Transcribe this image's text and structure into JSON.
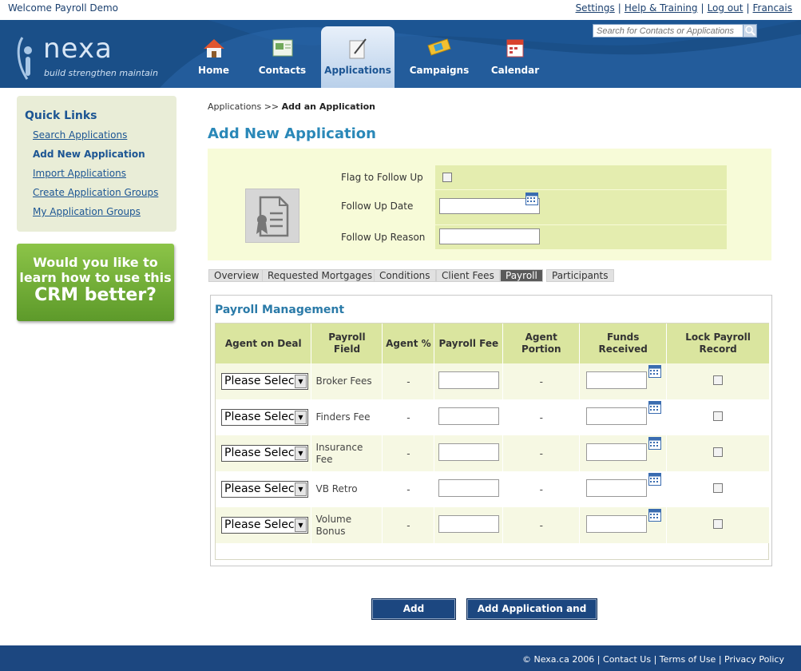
{
  "user": {
    "welcome": "Welcome Payroll Demo"
  },
  "top_links": [
    "Settings",
    "Help & Training",
    "Log out",
    "Francais"
  ],
  "logo": {
    "word": "nexa",
    "tagline": "build strengthen maintain"
  },
  "nav": [
    {
      "label": "Home",
      "icon": "house-icon"
    },
    {
      "label": "Contacts",
      "icon": "contacts-icon"
    },
    {
      "label": "Applications",
      "icon": "pen-document-icon",
      "active": true
    },
    {
      "label": "Campaigns",
      "icon": "campaign-icon"
    },
    {
      "label": "Calendar",
      "icon": "calendar-icon"
    }
  ],
  "search": {
    "placeholder": "Search for Contacts or Applications"
  },
  "quick_links": {
    "title": "Quick Links",
    "items": [
      "Search Applications",
      "Add New Application",
      "Import Applications",
      "Create Application Groups",
      "My Application Groups"
    ]
  },
  "promo": {
    "line1": "Would you like to",
    "line2": "learn how to use this",
    "line3": "CRM better?"
  },
  "breadcrumb": {
    "root": "Applications",
    "sep": ">>",
    "current": "Add an Application"
  },
  "page_title": "Add New Application",
  "follow_up": {
    "flag_label": "Flag to Follow Up",
    "date_label": "Follow Up Date",
    "reason_label": "Follow Up Reason"
  },
  "tabs": [
    "Overview",
    "Requested Mortgages",
    "Conditions",
    "Client Fees",
    "Payroll",
    "Participants"
  ],
  "active_tab": "Payroll",
  "payroll": {
    "title": "Payroll Management",
    "headers": [
      "Agent on Deal",
      "Payroll Field",
      "Agent %",
      "Payroll Fee",
      "Agent Portion",
      "Funds Received",
      "Lock Payroll Record"
    ],
    "select_value": "Please Select",
    "rows": [
      {
        "field": "Broker Fees",
        "agent_pct": "-",
        "agent_portion": "-"
      },
      {
        "field": "Finders Fee",
        "agent_pct": "-",
        "agent_portion": "-"
      },
      {
        "field": "Insurance Fee",
        "agent_pct": "-",
        "agent_portion": "-"
      },
      {
        "field": "VB Retro",
        "agent_pct": "-",
        "agent_portion": "-"
      },
      {
        "field": "Volume Bonus",
        "agent_pct": "-",
        "agent_portion": "-"
      }
    ]
  },
  "buttons": {
    "add": "Add Application",
    "add_close": "Add Application and Close"
  },
  "footer": {
    "text": "© Nexa.ca 2006 | Contact Us | Terms of Use | Privacy Policy"
  },
  "colors": {
    "brand_blue": "#1c5593",
    "footer_blue": "#1c4780",
    "title_blue": "#2a88b8",
    "header_green": "#dae59f"
  }
}
